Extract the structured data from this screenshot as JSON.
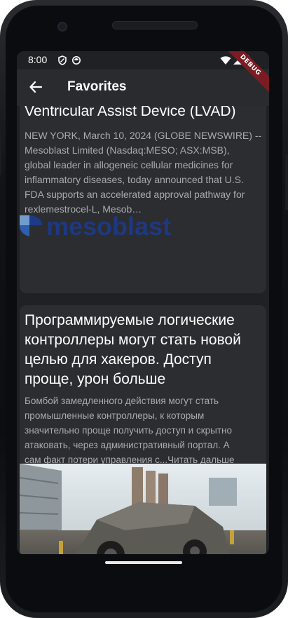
{
  "status_bar": {
    "time": "8:00",
    "icons": [
      "shield-icon",
      "sync-icon",
      "wifi-icon",
      "signal-icon",
      "battery-icon"
    ]
  },
  "debug_banner": "DEBUG",
  "app_bar": {
    "title": "Favorites",
    "back_icon": "arrow-back-icon"
  },
  "articles": [
    {
      "title": "Ventricular Assist Device (LVAD)",
      "body_lines": [
        "NEW YORK, March 10, 2024 (GLOBE NEWSWIRE) --",
        "Mesoblast Limited (Nasdaq:MESO; ASX:MSB),",
        "global leader in allogeneic cellular medicines for",
        "inflammatory diseases, today announced that U.S.",
        "FDA supports an accelerated approval pathway for",
        "rexlemestrocel-L, Mesob…"
      ],
      "image_text": "mesoblast"
    },
    {
      "title_lines": [
        "Программируемые логические",
        "контроллеры могут стать новой",
        "целью для хакеров. Доступ",
        "проще, урон больше"
      ],
      "body_lines": [
        "Бомбой замедленного действия могут стать",
        "промышленные контроллеры, к которым",
        "значительно проще получить доступ и скрытно",
        "атаковать, через административный портал. А",
        "сам факт потери управления с...Читать дальше"
      ]
    }
  ],
  "colors": {
    "background": "#202124",
    "app_bar": "#2a2b2e",
    "card": "#2c2d30",
    "title_text": "#ffffff",
    "body_text": "#a9aaad",
    "logo_blue": "#1d3a8a",
    "debug_banner": "#7a1c22"
  }
}
